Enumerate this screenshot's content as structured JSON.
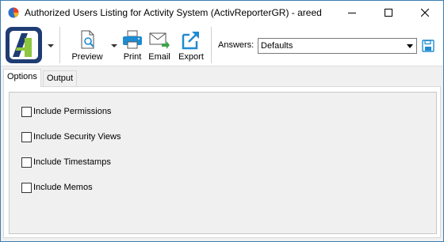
{
  "window": {
    "title": "Authorized Users Listing for Activity System (ActivReporterGR) - areed"
  },
  "toolbar": {
    "preview_label": "Preview",
    "print_label": "Print",
    "email_label": "Email",
    "export_label": "Export",
    "answers_label": "Answers:",
    "answers_value": "Defaults"
  },
  "tabs": [
    {
      "label": "Options",
      "active": true
    },
    {
      "label": "Output",
      "active": false
    }
  ],
  "options": [
    {
      "label": "Include Permissions",
      "checked": false
    },
    {
      "label": "Include Security Views",
      "checked": false
    },
    {
      "label": "Include Timestamps",
      "checked": false
    },
    {
      "label": "Include Memos",
      "checked": false
    }
  ],
  "colors": {
    "accent_blue": "#1e8bd2",
    "logo_green": "#8dc63f",
    "logo_navy": "#1f3c73"
  }
}
